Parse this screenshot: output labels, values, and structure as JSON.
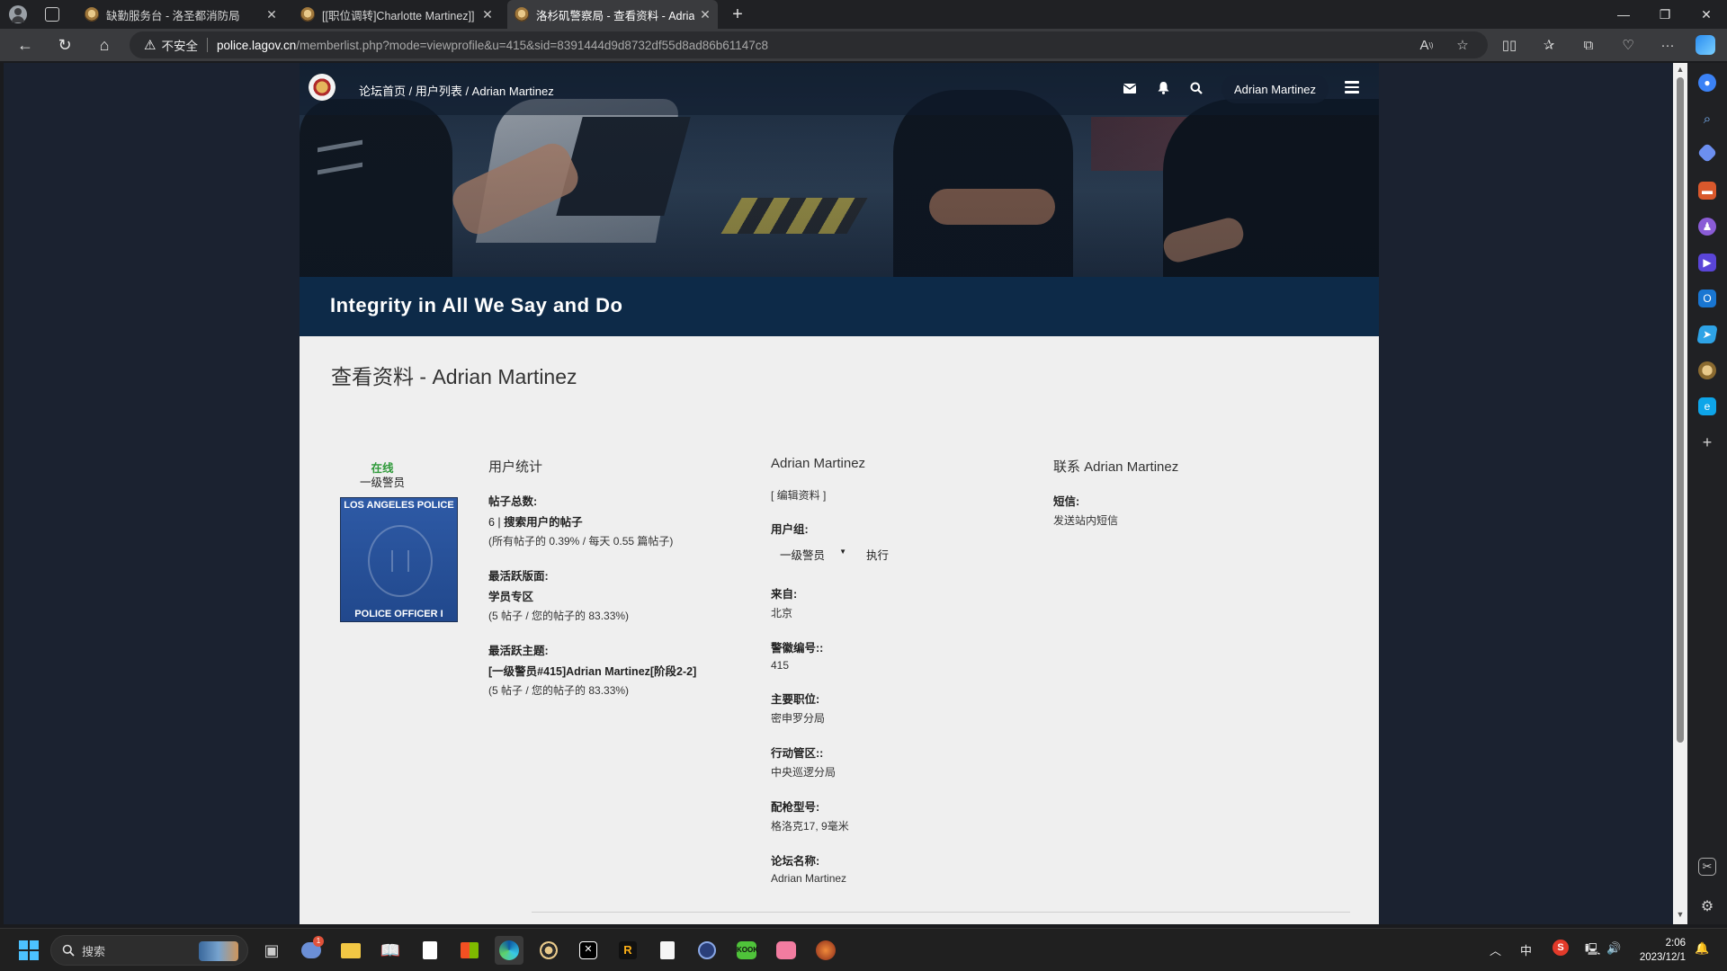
{
  "browser": {
    "tabs": [
      {
        "title": "缺勤服务台 - 洛圣都消防局"
      },
      {
        "title": "[[职位调转]Charlotte Martinez]]"
      },
      {
        "title": "洛杉矶警察局 - 查看资料 - Adrian Martinez"
      }
    ],
    "address": {
      "security": "不安全",
      "host": "police.lagov.cn",
      "path": "/memberlist.php?mode=viewprofile&u=415&sid=8391444d9d8732df55d8ad86b61147c8"
    }
  },
  "site": {
    "breadcrumb": "论坛首页 / 用户列表 / Adrian Martinez",
    "username": "Adrian Martinez",
    "slogan": "Integrity in All We Say and Do",
    "page_title": "查看资料 - Adrian Martinez"
  },
  "profile": {
    "status": "在线",
    "rank": "一级警员",
    "badge_top": "LOS ANGELES POLICE",
    "badge_bottom": "POLICE OFFICER I",
    "stats": {
      "heading": "用户统计",
      "posts_label": "帖子总数:",
      "posts_count": "6",
      "posts_sep": " | ",
      "posts_link": "搜索用户的帖子",
      "posts_detail": "(所有帖子的 0.39% / 每天 0.55 篇帖子)",
      "forum_label": "最活跃版面:",
      "forum_value": "学员专区",
      "forum_detail": "(5 帖子 / 您的帖子的 83.33%)",
      "topic_label": "最活跃主题:",
      "topic_value": "[一级警员#415]Adrian Martinez[阶段2-2]",
      "topic_detail": "(5 帖子 / 您的帖子的 83.33%)"
    },
    "info": {
      "heading": "Adrian Martinez",
      "edit": "[ 编辑资料 ]",
      "group_label": "用户组:",
      "group_value": "一级警员",
      "group_action": "执行",
      "from_label": "来自:",
      "from_value": "北京",
      "badge_no_label": "警徽编号::",
      "badge_no_value": "415",
      "post_label": "主要职位:",
      "post_value": "密申罗分局",
      "area_label": "行动管区::",
      "area_value": "中央巡逻分局",
      "gun_label": "配枪型号:",
      "gun_value": "格洛克17, 9毫米",
      "forum_name_label": "论坛名称:",
      "forum_name_value": "Adrian Martinez"
    },
    "contact": {
      "heading": "联系 Adrian Martinez",
      "pm_label": "短信:",
      "pm_value": "发送站内短信"
    }
  },
  "taskbar": {
    "search": "搜索",
    "ime": "中",
    "time": "2:06",
    "date": "2023/12/1"
  },
  "colors": {
    "slogan_bg": "#0d2a48",
    "online": "#2f9a3a",
    "page_bg": "#efefef"
  }
}
